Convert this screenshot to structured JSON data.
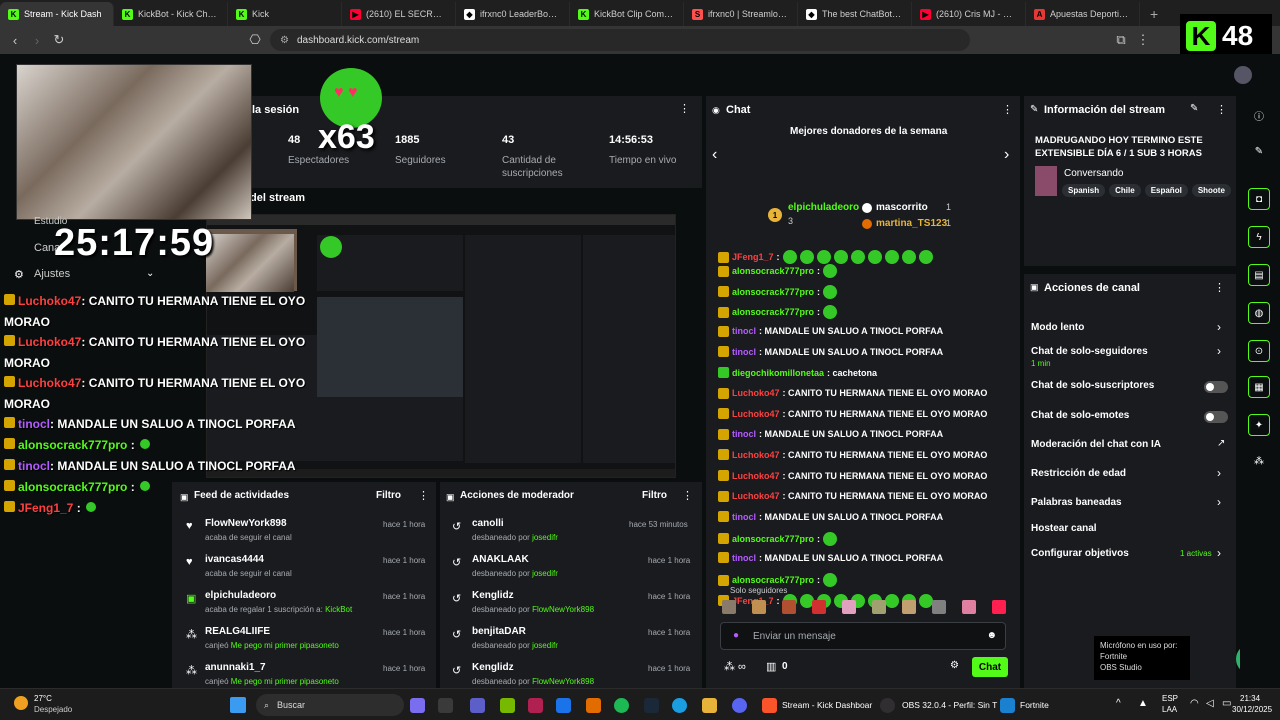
{
  "browser": {
    "tabs": [
      {
        "label": "Stream - Kick Dash",
        "active": true,
        "fav_color": "#53fc18",
        "fav": "K"
      },
      {
        "label": "KickBot - Kick Chatbo",
        "fav_color": "#53fc18",
        "fav": "K"
      },
      {
        "label": "Kick",
        "fav_color": "#53fc18",
        "fav": "K"
      },
      {
        "label": "(2610) EL SECRETO FIN",
        "fav_color": "#ff0033",
        "fav": "▶"
      },
      {
        "label": "ifrxnc0 LeaderBoard | T",
        "fav_color": "#ffffff",
        "fav": "◆"
      },
      {
        "label": "KickBot Clip Command",
        "fav_color": "#53fc18",
        "fav": "K"
      },
      {
        "label": "ifrxnc0 | Streamloots |",
        "fav_color": "#ff5050",
        "fav": "S"
      },
      {
        "label": "The best ChatBot and",
        "fav_color": "#ffffff",
        "fav": "◆"
      },
      {
        "label": "(2610) Cris MJ - Botell",
        "fav_color": "#ff0033",
        "fav": "▶"
      },
      {
        "label": "Apuestas Deportivas -",
        "fav_color": "#e53935",
        "fav": "A"
      }
    ],
    "new_tab": "+",
    "url": "dashboard.kick.com/stream"
  },
  "kick_badge": {
    "letter": "K",
    "count": "48"
  },
  "overlay": {
    "emote_multiplier": "x63",
    "timer": "25:17:59",
    "menu": [
      "Estudio",
      "Cana",
      "Ajustes"
    ],
    "chat_lines": [
      {
        "user": "Luchoko47",
        "text": ": CANITO TU HERMANA TIENE EL OYO",
        "cont": "MORAO",
        "color": "#ff4040"
      },
      {
        "user": "Luchoko47",
        "text": ": CANITO TU HERMANA TIENE EL OYO",
        "cont": "MORAO",
        "color": "#ff4040"
      },
      {
        "user": "Luchoko47",
        "text": ": CANITO TU HERMANA TIENE EL OYO",
        "cont": "MORAO",
        "color": "#ff4040"
      },
      {
        "user": "tinocl",
        "text": ": MANDALE UN SALUO A TINOCL PORFAA",
        "color": "#b45cff"
      },
      {
        "user": "alonsocrack777pro",
        "text": " : ",
        "color": "#53fc18"
      },
      {
        "user": "tinocl",
        "text": ": MANDALE UN SALUO A TINOCL PORFAA",
        "color": "#b45cff"
      },
      {
        "user": "alonsocrack777pro",
        "text": " : ",
        "color": "#53fc18"
      },
      {
        "user": "JFeng1_7",
        "text": " : ",
        "color": "#ff4040"
      }
    ]
  },
  "stats": {
    "session_title": "la sesión",
    "items": [
      {
        "value": "48",
        "label": "Espectadores"
      },
      {
        "value": "1885",
        "label": "Seguidores"
      },
      {
        "value": "43",
        "label": "Cantidad de suscripciones"
      },
      {
        "value": "14:56:53",
        "label": "Tiempo en vivo"
      }
    ],
    "preview_title": "del stream"
  },
  "activity_feed": {
    "title": "Feed de actividades",
    "filter": "Filtro",
    "items": [
      {
        "name": "FlowNewYork898",
        "sub": "acaba de seguir el canal",
        "time": "hace 1 hora",
        "icon": "♥"
      },
      {
        "name": "ivancas4444",
        "sub": "acaba de seguir el canal",
        "time": "hace 1 hora",
        "icon": "♥"
      },
      {
        "name": "elpichuladeoro",
        "sub": "acaba de regalar 1 suscripción a: ",
        "sub_link": "KickBot",
        "time": "hace 1 hora",
        "icon": "▣"
      },
      {
        "name": "REALG4LIIFE",
        "sub": "canjeó ",
        "sub_link": "Me pego mi primer pipasoneto",
        "time": "hace 1 hora",
        "icon": "⁂"
      },
      {
        "name": "anunnaki1_7",
        "sub": "canjeó ",
        "sub_link": "Me pego mi primer pipasoneto",
        "time": "hace 1 hora",
        "icon": "⁂"
      }
    ]
  },
  "mod_actions": {
    "title": "Acciones de moderador",
    "filter": "Filtro",
    "items": [
      {
        "name": "canolli",
        "sub": "desbaneado por ",
        "by": "josedifr",
        "time": "hace 53 minutos"
      },
      {
        "name": "ANAKLAAK",
        "sub": "desbaneado por ",
        "by": "josedifr",
        "time": "hace 1 hora"
      },
      {
        "name": "Kenglidz",
        "sub": "desbaneado por ",
        "by": "FlowNewYork898",
        "time": "hace 1 hora"
      },
      {
        "name": "benjitaDAR",
        "sub": "desbaneado por ",
        "by": "josedifr",
        "time": "hace 1 hora"
      },
      {
        "name": "Kenglidz",
        "sub": "desbaneado por ",
        "by": "FlowNewYork898",
        "time": "hace 1 hora"
      }
    ]
  },
  "chat": {
    "title": "Chat",
    "donors_title": "Mejores donadores de la semana",
    "donors": [
      {
        "rank": "1",
        "name": "elpichuladeoro",
        "amount": "3"
      },
      {
        "rank": "",
        "name": "mascorrito",
        "amount": "1"
      },
      {
        "rank": "",
        "name": "martina_TS123",
        "amount": "1"
      }
    ],
    "messages": [
      {
        "user": "JFeng1_7",
        "text": ": ",
        "color": "#ff4040",
        "emotes": 9
      },
      {
        "user": "alonsocrack777pro",
        "text": ": ",
        "color": "#53fc18",
        "emotes": 1
      },
      {
        "user": "alonsocrack777pro",
        "text": ": ",
        "color": "#53fc18",
        "emotes": 1
      },
      {
        "user": "alonsocrack777pro",
        "text": ": ",
        "color": "#53fc18",
        "emotes": 1
      },
      {
        "user": "tinocl",
        "text": ": MANDALE UN SALUO A TINOCL PORFAA",
        "color": "#b45cff",
        "emotes": 0
      },
      {
        "user": "tinocl",
        "text": ": MANDALE UN SALUO A TINOCL PORFAA",
        "color": "#b45cff",
        "emotes": 0
      },
      {
        "user": "diegochikomillonetaa",
        "text": ": cachetona",
        "color": "#53fc18",
        "emotes": 0
      },
      {
        "user": "Luchoko47",
        "text": ": CANITO TU HERMANA TIENE EL OYO MORAO",
        "color": "#ff4040",
        "emotes": 0
      },
      {
        "user": "Luchoko47",
        "text": ": CANITO TU HERMANA TIENE EL OYO MORAO",
        "color": "#ff4040",
        "emotes": 0
      },
      {
        "user": "tinocl",
        "text": ": MANDALE UN SALUO A TINOCL PORFAA",
        "color": "#b45cff",
        "emotes": 0
      },
      {
        "user": "Luchoko47",
        "text": ": CANITO TU HERMANA TIENE EL OYO MORAO",
        "color": "#ff4040",
        "emotes": 0
      },
      {
        "user": "Luchoko47",
        "text": ": CANITO TU HERMANA TIENE EL OYO MORAO",
        "color": "#ff4040",
        "emotes": 0
      },
      {
        "user": "Luchoko47",
        "text": ": CANITO TU HERMANA TIENE EL OYO MORAO",
        "color": "#ff4040",
        "emotes": 0
      },
      {
        "user": "tinocl",
        "text": ": MANDALE UN SALUO A TINOCL PORFAA",
        "color": "#b45cff",
        "emotes": 0
      },
      {
        "user": "alonsocrack777pro",
        "text": ": ",
        "color": "#53fc18",
        "emotes": 1
      },
      {
        "user": "tinocl",
        "text": ": MANDALE UN SALUO A TINOCL PORFAA",
        "color": "#b45cff",
        "emotes": 0
      },
      {
        "user": "alonsocrack777pro",
        "text": ": ",
        "color": "#53fc18",
        "emotes": 1
      },
      {
        "user": "JFeng1_7",
        "text": ": ",
        "color": "#ff4040",
        "emotes": 9
      }
    ],
    "followers_only": "Solo seguidores",
    "input_placeholder": "Enviar un mensaje",
    "points": "0",
    "send": "Chat"
  },
  "stream_info": {
    "title": "Información del stream",
    "stream_title": "MADRUGANDO HOY TERMINO ESTE EXTENSIBLE DÍA 6 / 1 SUB 3 HORAS",
    "category": "Conversando",
    "tags": [
      "Spanish",
      "Chile",
      "Español",
      "Shoote"
    ]
  },
  "channel_actions": {
    "title": "Acciones de canal",
    "items": [
      {
        "label": "Modo lento",
        "type": "chevron"
      },
      {
        "label": "Chat de solo-seguidores",
        "sub": "1 min",
        "type": "chevron"
      },
      {
        "label": "Chat de solo-suscriptores",
        "type": "toggle"
      },
      {
        "label": "Chat de solo-emotes",
        "type": "toggle"
      },
      {
        "label": "Moderación del chat con IA",
        "type": "ext"
      },
      {
        "label": "Restricción de edad",
        "type": "chevron"
      },
      {
        "label": "Palabras baneadas",
        "type": "chevron"
      },
      {
        "label": "Hostear canal",
        "type": "none"
      },
      {
        "label": "Configurar objetivos",
        "sub_right": "1 activas",
        "type": "chevron"
      }
    ]
  },
  "mic_tooltip": {
    "line1": "Micrófono en uso por:",
    "line2": "Fortnite",
    "line3": "OBS Studio"
  },
  "taskbar": {
    "weather_temp": "27°C",
    "weather_desc": "Despejado",
    "search": "Buscar",
    "apps": [
      {
        "label": "Stream - Kick Dashboar"
      },
      {
        "label": "OBS 32.0.4 - Perfil: Sin T"
      },
      {
        "label": "Fortnite"
      }
    ],
    "lang1": "ESP",
    "lang2": "LAA",
    "time": "21:34",
    "date": "30/12/2025"
  },
  "colors": {
    "accent": "#53fc18",
    "panel": "#191b1f",
    "bg": "#0b0e0f"
  }
}
